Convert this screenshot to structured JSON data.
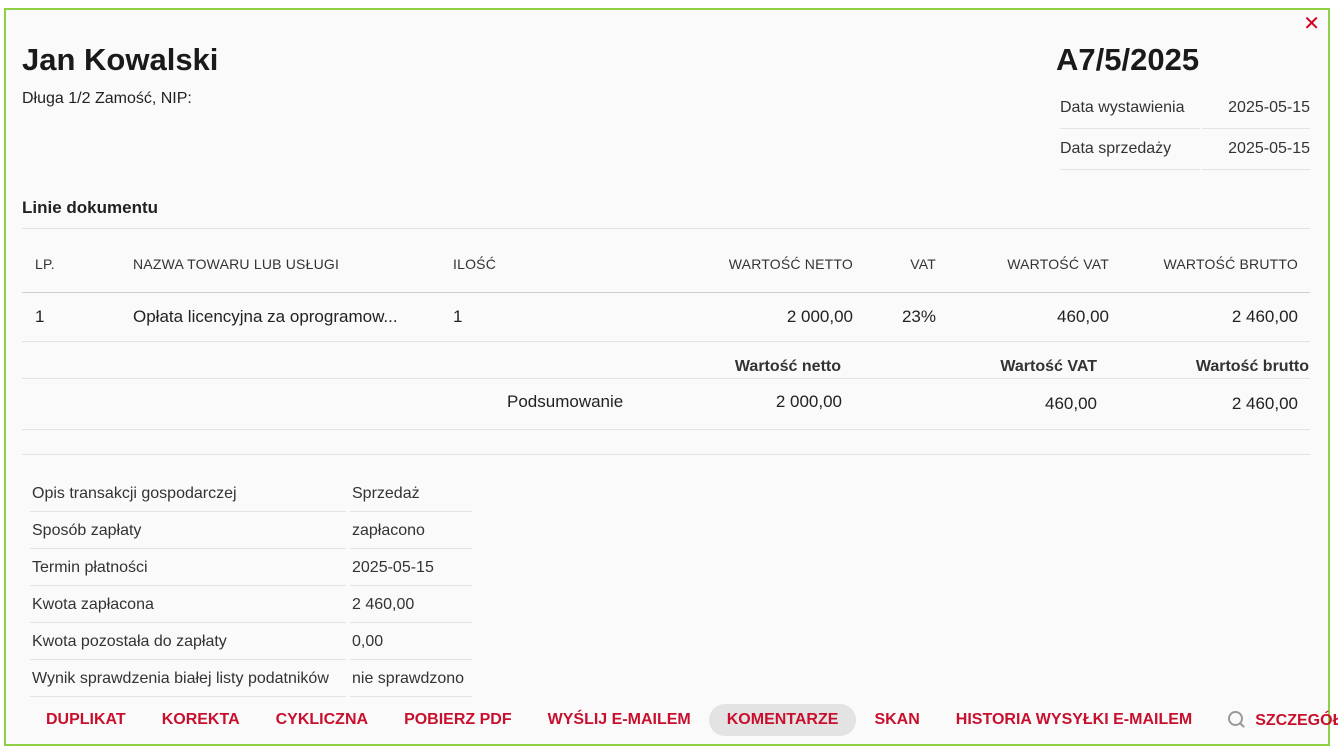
{
  "header": {
    "client_name": "Jan Kowalski",
    "client_address": "Długa 1/2 Zamość, NIP:",
    "document_number": "A7/5/2025",
    "close_icon": "close-icon",
    "dates": [
      {
        "label": "Data wystawienia",
        "value": "2025-05-15"
      },
      {
        "label": "Data sprzedaży",
        "value": "2025-05-15"
      }
    ]
  },
  "lines": {
    "title": "Linie dokumentu",
    "columns": [
      "LP.",
      "NAZWA TOWARU LUB USŁUGI",
      "ILOŚĆ",
      "WARTOŚĆ NETTO",
      "VAT",
      "WARTOŚĆ VAT",
      "WARTOŚĆ BRUTTO"
    ],
    "rows": [
      {
        "lp": "1",
        "name": "Opłata licencyjna za oprogramow...",
        "qty": "1",
        "netto": "2 000,00",
        "vat": "23%",
        "vat_value": "460,00",
        "brutto": "2 460,00"
      }
    ]
  },
  "summary": {
    "headers": {
      "netto": "Wartość netto",
      "vat": "Wartość VAT",
      "brutto": "Wartość brutto"
    },
    "label": "Podsumowanie",
    "netto": "2 000,00",
    "vat": "460,00",
    "brutto": "2 460,00"
  },
  "details": [
    {
      "label": "Opis transakcji gospodarczej",
      "value": "Sprzedaż"
    },
    {
      "label": "Sposób zapłaty",
      "value": "zapłacono"
    },
    {
      "label": "Termin płatności",
      "value": "2025-05-15"
    },
    {
      "label": "Kwota zapłacona",
      "value": "2 460,00"
    },
    {
      "label": "Kwota pozostała do zapłaty",
      "value": "0,00"
    },
    {
      "label": "Wynik sprawdzenia białej listy podatników",
      "value": "nie sprawdzono"
    }
  ],
  "actions": [
    {
      "label": "DUPLIKAT"
    },
    {
      "label": "KOREKTA"
    },
    {
      "label": "CYKLICZNA"
    },
    {
      "label": "POBIERZ PDF"
    },
    {
      "label": "WYŚLIJ E-MAILEM"
    },
    {
      "label": "KOMENTARZE",
      "active": true
    },
    {
      "label": "SKAN"
    },
    {
      "label": "HISTORIA WYSYŁKI E-MAILEM"
    },
    {
      "label": "SZCZEGÓŁY",
      "icon": "search-icon"
    }
  ],
  "colors": {
    "border": "#8ed046",
    "accent": "#c8102e",
    "active_bg": "#e3e3e3"
  }
}
